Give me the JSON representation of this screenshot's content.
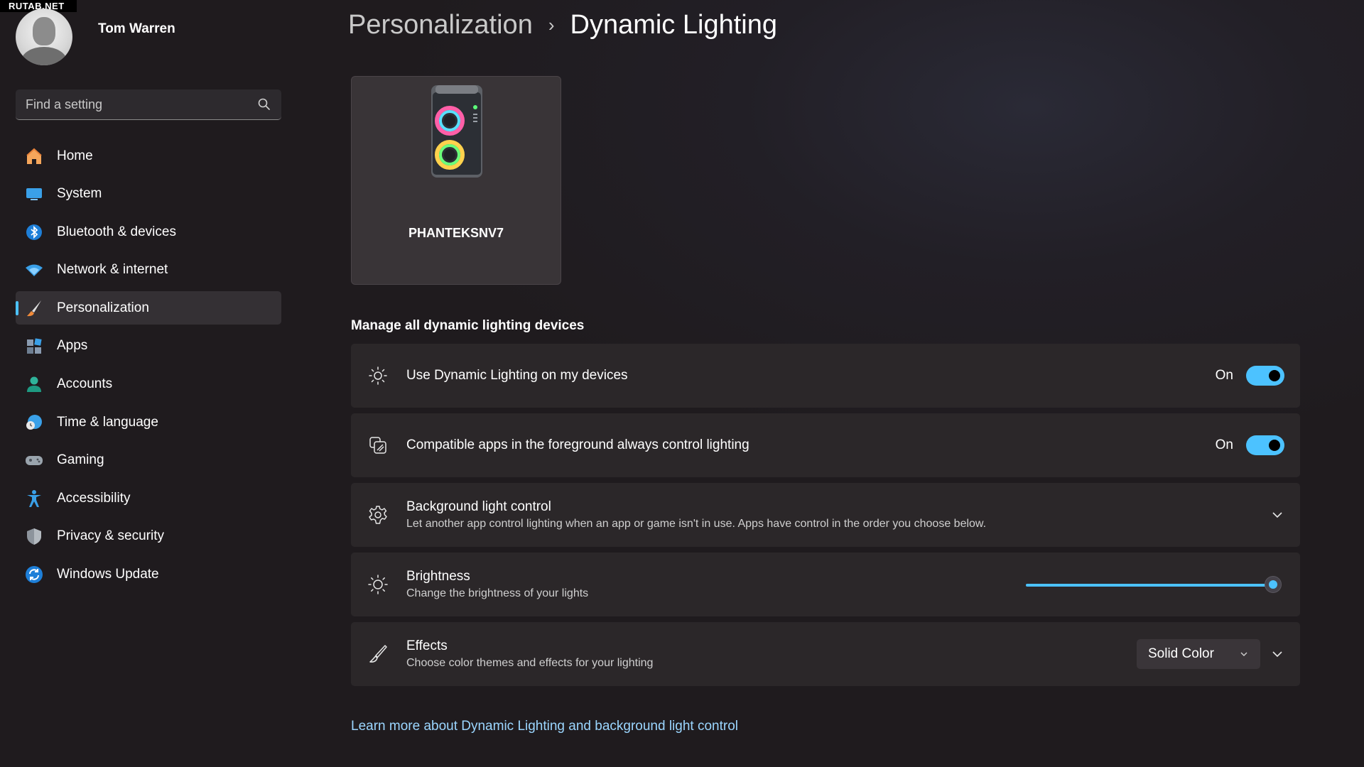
{
  "watermark": "RUTAB.NET",
  "profile": {
    "name": "Tom Warren"
  },
  "search": {
    "placeholder": "Find a setting",
    "icon": "search-icon"
  },
  "sidebar": {
    "items": [
      {
        "label": "Home",
        "icon": "home-icon"
      },
      {
        "label": "System",
        "icon": "system-icon"
      },
      {
        "label": "Bluetooth & devices",
        "icon": "bluetooth-icon"
      },
      {
        "label": "Network & internet",
        "icon": "wifi-icon"
      },
      {
        "label": "Personalization",
        "icon": "brush-icon",
        "active": true
      },
      {
        "label": "Apps",
        "icon": "apps-icon"
      },
      {
        "label": "Accounts",
        "icon": "accounts-icon"
      },
      {
        "label": "Time & language",
        "icon": "time-language-icon"
      },
      {
        "label": "Gaming",
        "icon": "gaming-icon"
      },
      {
        "label": "Accessibility",
        "icon": "accessibility-icon"
      },
      {
        "label": "Privacy & security",
        "icon": "shield-icon"
      },
      {
        "label": "Windows Update",
        "icon": "update-icon"
      }
    ]
  },
  "header": {
    "parent": "Personalization",
    "separator": "›",
    "current": "Dynamic Lighting"
  },
  "device": {
    "name": "PHANTEKSNV7"
  },
  "section": {
    "title": "Manage all dynamic lighting devices"
  },
  "settings": {
    "use_dynamic": {
      "title": "Use Dynamic Lighting on my devices",
      "state_label": "On",
      "on": true
    },
    "foreground_apps": {
      "title": "Compatible apps in the foreground always control lighting",
      "state_label": "On",
      "on": true
    },
    "background_control": {
      "title": "Background light control",
      "desc": "Let another app control lighting when an app or game isn't in use. Apps have control in the order you choose below."
    },
    "brightness": {
      "title": "Brightness",
      "desc": "Change the brightness of your lights",
      "value": 100
    },
    "effects": {
      "title": "Effects",
      "desc": "Choose color themes and effects for your lighting",
      "selected": "Solid Color"
    }
  },
  "link": {
    "text": "Learn more about Dynamic Lighting and background light control"
  },
  "colors": {
    "accent": "#4cc2ff",
    "card": "#2b2729",
    "background": "#1f1b1e"
  }
}
